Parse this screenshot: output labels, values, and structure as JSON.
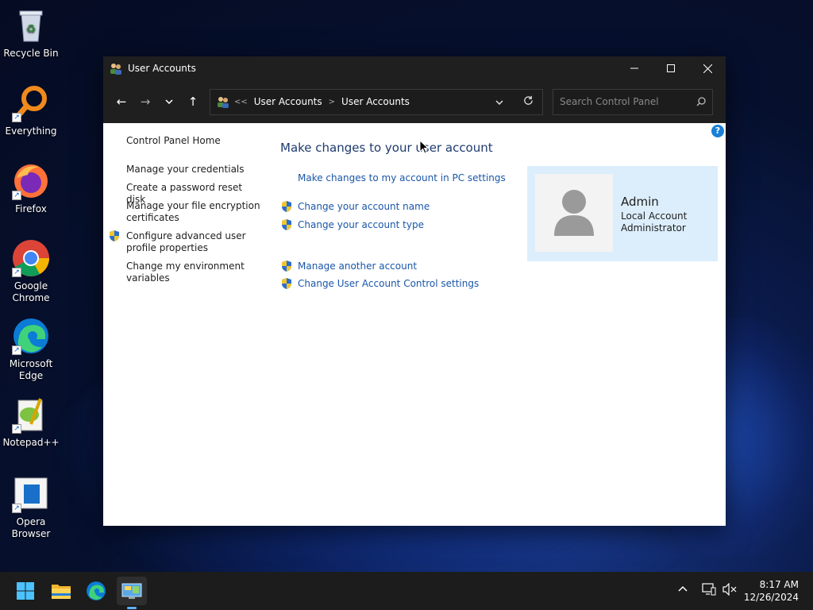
{
  "desktop": {
    "icons": [
      {
        "label": "Recycle Bin"
      },
      {
        "label": "Everything"
      },
      {
        "label": "Firefox"
      },
      {
        "label": "Google Chrome"
      },
      {
        "label": "Microsoft Edge"
      },
      {
        "label": "Notepad++"
      },
      {
        "label": "Opera Browser"
      }
    ]
  },
  "window": {
    "title": "User Accounts",
    "address": {
      "overflow": "<<",
      "crumbs": [
        "User Accounts",
        "User Accounts"
      ]
    },
    "search_placeholder": "Search Control Panel",
    "left_links": [
      "Control Panel Home",
      "Manage your credentials",
      "Create a password reset disk",
      "Manage your file encryption certificates",
      "Configure advanced user profile properties",
      "Change my environment variables"
    ],
    "main_title": "Make changes to your user account",
    "tasks": [
      "Make changes to my account in PC settings",
      "Change your account name",
      "Change your account type",
      "Manage another account",
      "Change User Account Control settings"
    ],
    "account": {
      "name": "Admin",
      "type": "Local Account",
      "role": "Administrator"
    }
  },
  "taskbar": {
    "time": "8:17 AM",
    "date": "12/26/2024"
  }
}
